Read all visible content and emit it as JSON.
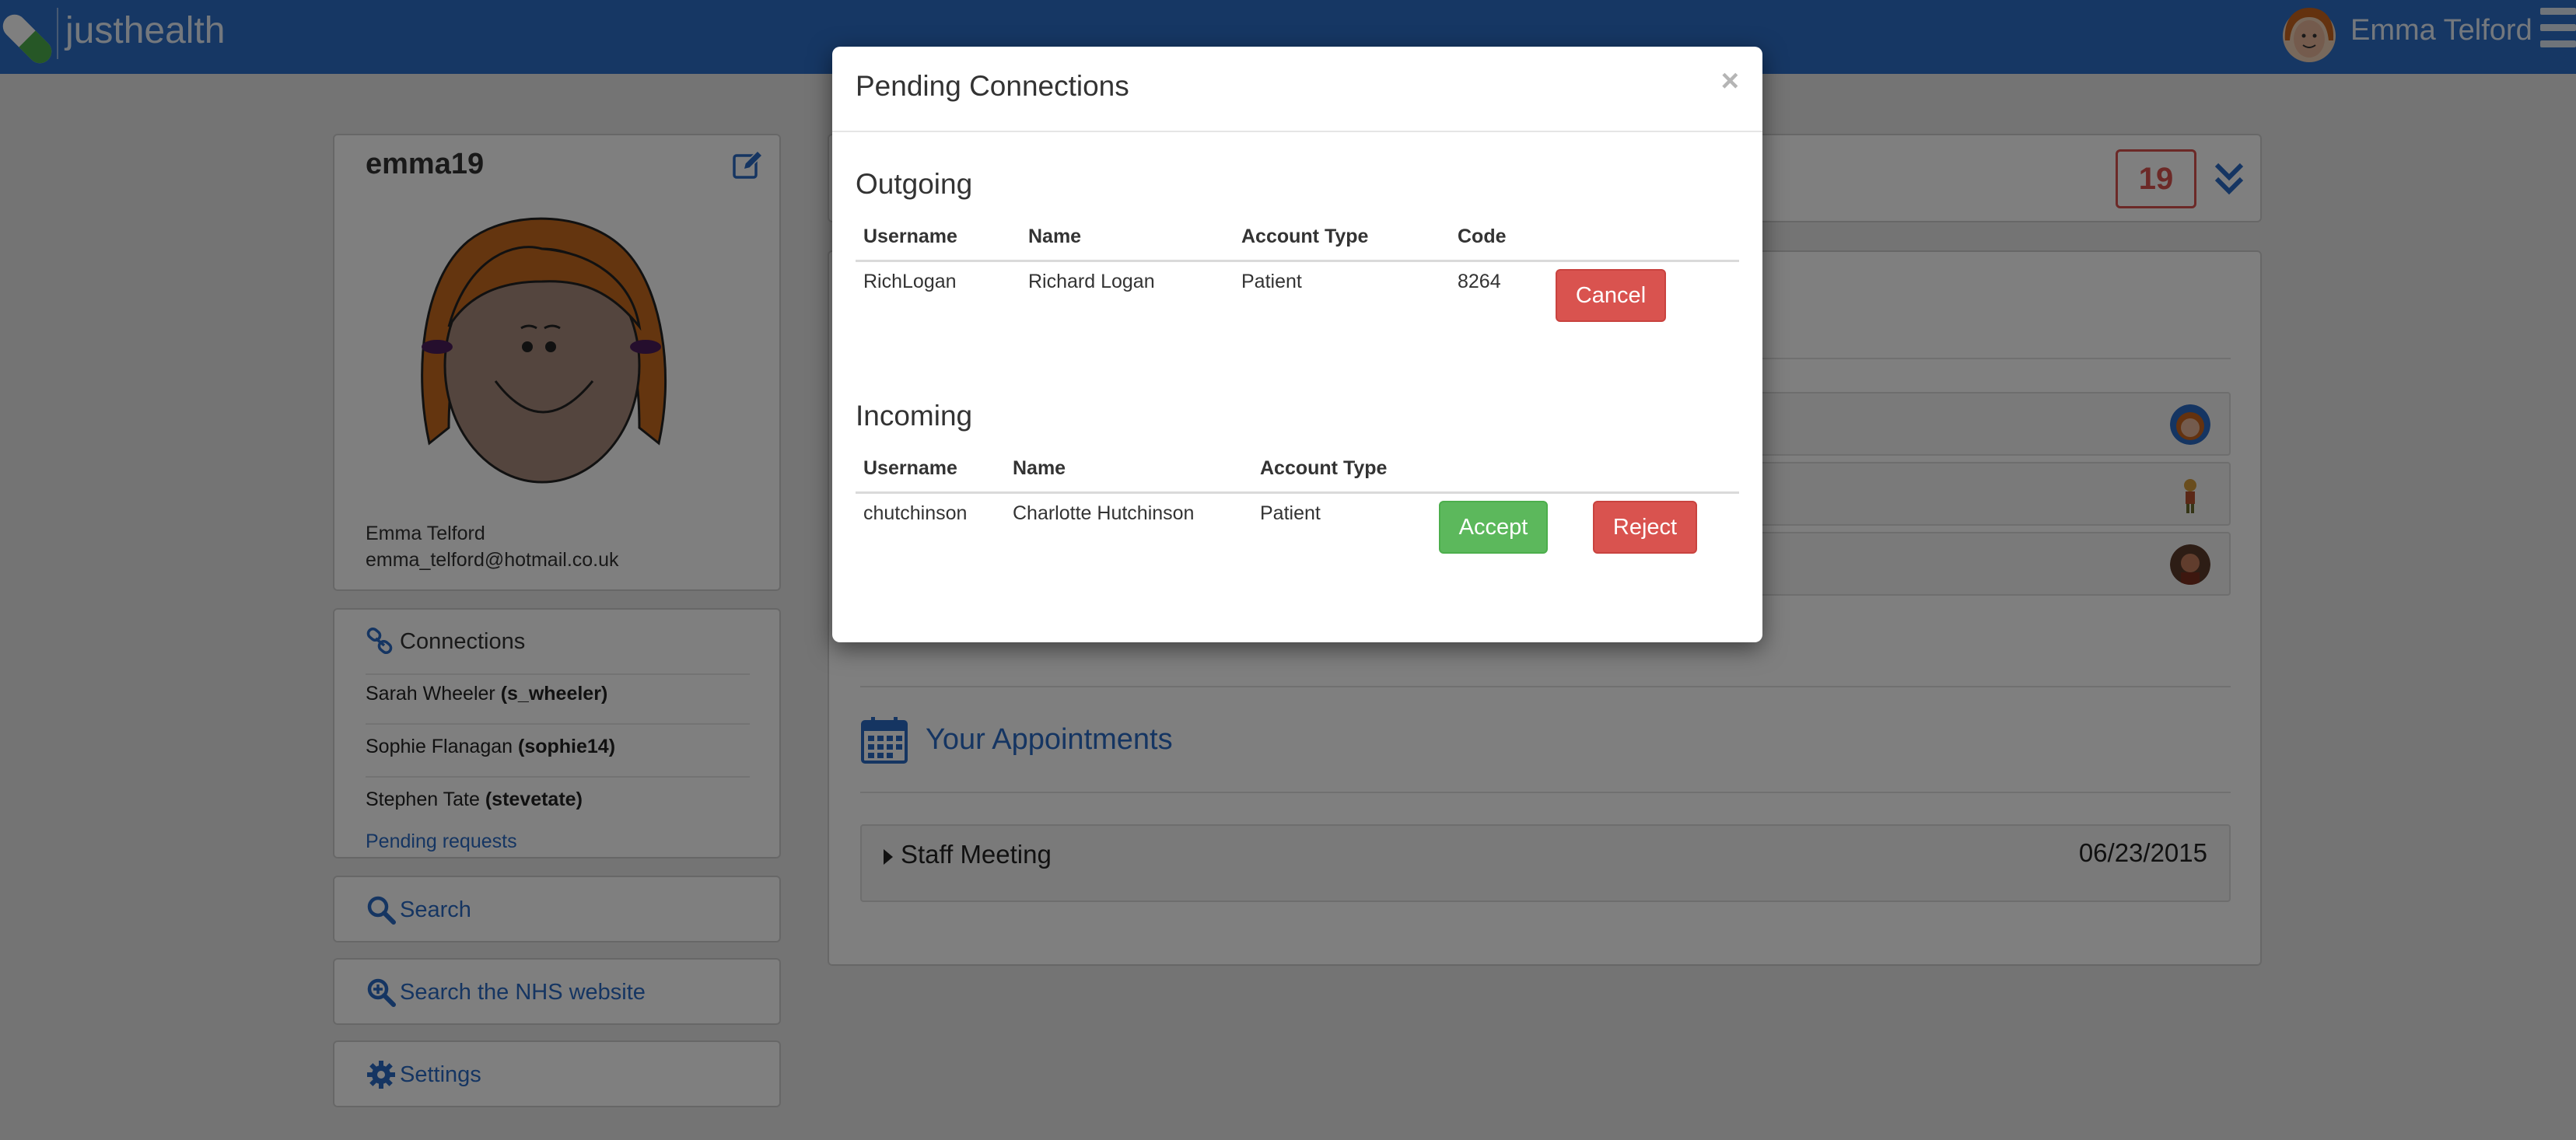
{
  "navbar": {
    "brand": "justhealth",
    "user_name": "Emma Telford",
    "icons": {
      "logo": "pill-logo-icon",
      "menu": "hamburger-menu-icon"
    }
  },
  "profile": {
    "username": "emma19",
    "full_name": "Emma Telford",
    "email": "emma_telford@hotmail.co.uk",
    "edit_icon": "edit-icon"
  },
  "connections": {
    "title": "Connections",
    "items": [
      {
        "name": "Sarah Wheeler",
        "username": "(s_wheeler)"
      },
      {
        "name": "Sophie Flanagan",
        "username": "(sophie14)"
      },
      {
        "name": "Stephen Tate",
        "username": "(stevetate)"
      }
    ],
    "pending_link": "Pending requests"
  },
  "sidebar_buttons": {
    "search": "Search",
    "nhs_search": "Search the NHS website",
    "settings": "Settings"
  },
  "main": {
    "notification_count": "19",
    "appointments_title": "Your Appointments",
    "appointments": [
      {
        "name": "Staff Meeting",
        "date": "06/23/2015"
      }
    ]
  },
  "modal": {
    "title": "Pending Connections",
    "close_label": "×",
    "outgoing": {
      "title": "Outgoing",
      "headers": [
        "Username",
        "Name",
        "Account Type",
        "Code"
      ],
      "rows": [
        {
          "username": "RichLogan",
          "name": "Richard Logan",
          "account_type": "Patient",
          "code": "8264",
          "cancel_label": "Cancel"
        }
      ]
    },
    "incoming": {
      "title": "Incoming",
      "headers": [
        "Username",
        "Name",
        "Account Type"
      ],
      "rows": [
        {
          "username": "chutchinson",
          "name": "Charlotte Hutchinson",
          "account_type": "Patient",
          "accept_label": "Accept",
          "reject_label": "Reject"
        }
      ]
    }
  },
  "colors": {
    "navbar": "#2c6ec9",
    "link": "#2a6ac4",
    "danger": "#d9534f",
    "success": "#5cb85c"
  }
}
